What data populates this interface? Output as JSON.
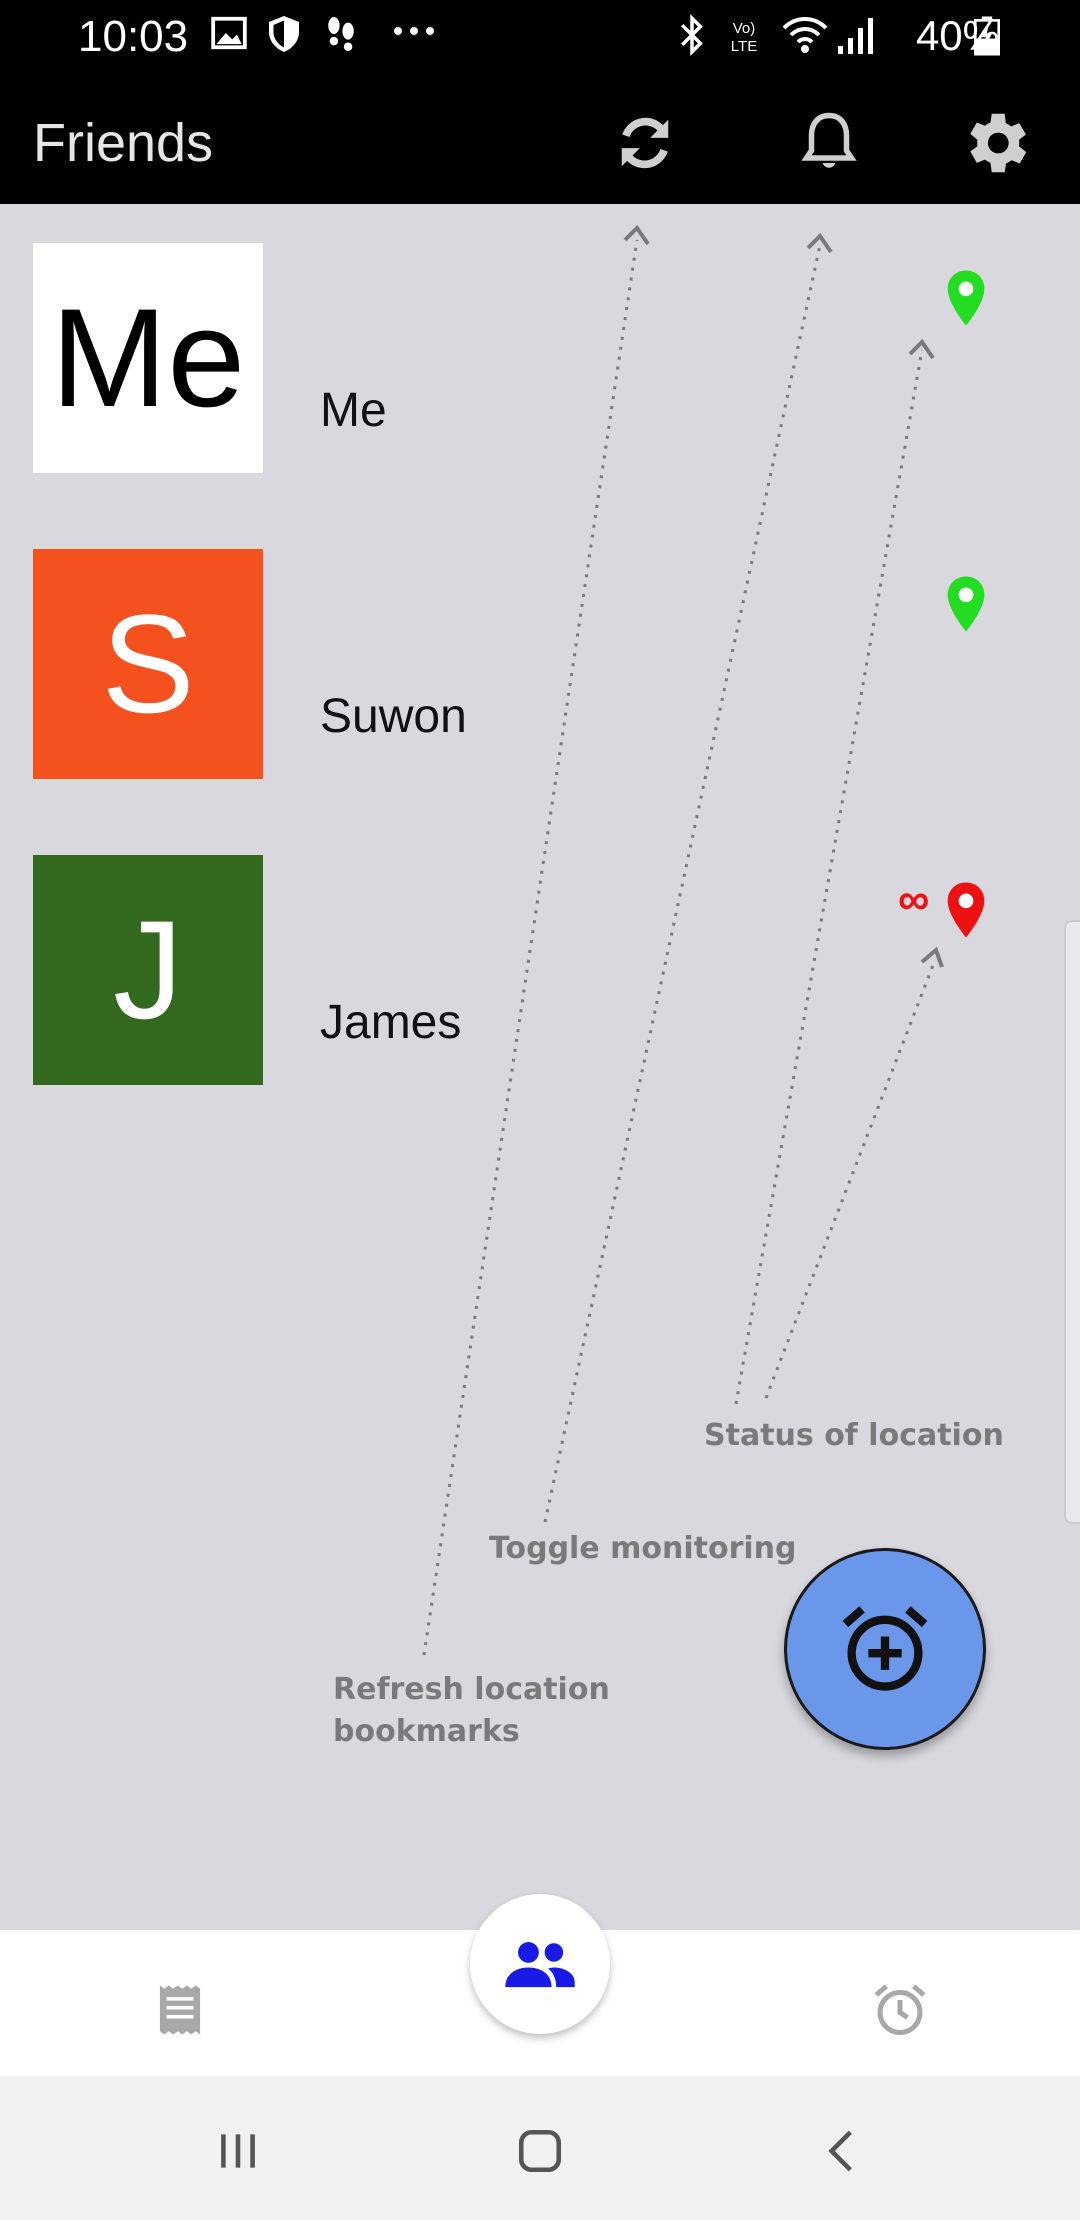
{
  "status_bar": {
    "time": "10:03",
    "battery": "40%",
    "icons": [
      "image-icon",
      "shield-icon",
      "footprints-icon",
      "more-icon",
      "bluetooth-icon",
      "volte-icon",
      "wifi-icon",
      "signal-icon",
      "battery-icon"
    ]
  },
  "app_bar": {
    "title": "Friends",
    "actions": [
      "refresh-icon",
      "bell-icon",
      "gear-icon"
    ]
  },
  "friends": [
    {
      "initials": "Me",
      "name": "Me",
      "avatar_bg": "#ffffff",
      "avatar_fg": "#000000",
      "pin_color": "#22dd22",
      "status": ""
    },
    {
      "initials": "S",
      "name": "Suwon",
      "avatar_bg": "#f4511e",
      "avatar_fg": "#ffffff",
      "pin_color": "#22dd22",
      "status": ""
    },
    {
      "initials": "J",
      "name": "James",
      "avatar_bg": "#33691e",
      "avatar_fg": "#ffffff",
      "pin_color": "#ee1111",
      "status": "∞"
    }
  ],
  "tutorial": {
    "status_of_location": "Status of location",
    "toggle_monitoring": "Toggle monitoring",
    "refresh_line1": "Refresh location",
    "refresh_line2": "bookmarks"
  },
  "fab": {
    "icon": "alarm-add-icon",
    "color": "#6b97ea"
  },
  "bottom_nav": {
    "items": [
      "list-icon",
      "people-icon",
      "alarm-icon"
    ],
    "active_color": "#1a1ae6"
  },
  "system_nav": [
    "recents-icon",
    "home-icon",
    "back-icon"
  ]
}
